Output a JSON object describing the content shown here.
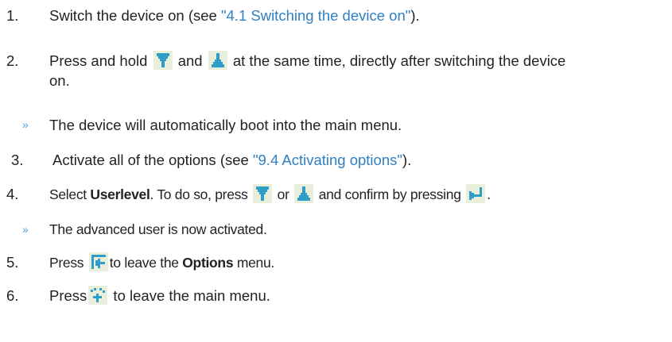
{
  "steps": [
    {
      "num": "1.",
      "pre": "Switch the device on (see ",
      "link": "\"4.1 Switching the device on\"",
      "post": ")."
    },
    {
      "num": "2.",
      "pre": "Press and hold",
      "mid": "and",
      "post": "at the same time, directly after switching the device",
      "line2": "on."
    },
    {
      "result": "The device will automatically boot into the main menu."
    },
    {
      "num": "3.",
      "pre": "Activate all of the options (see ",
      "link": "\"9.4 Activating options\"",
      "post": ")."
    },
    {
      "num": "4.",
      "pre": "Select ",
      "bold": "Userlevel",
      "mid1": ". To do so, press",
      "mid2": "or",
      "mid3": "and confirm by pressing",
      "post": "."
    },
    {
      "result": "The advanced user is now activated."
    },
    {
      "num": "5.",
      "pre": "Press",
      "mid": "to leave the ",
      "bold": "Options",
      "post": " menu."
    },
    {
      "num": "6.",
      "pre": "Press",
      "post": " to leave the main menu."
    }
  ],
  "result_marker": "»",
  "icons": {
    "down": "arrow-down-icon",
    "up": "arrow-up-icon",
    "enter": "enter-icon",
    "back": "back-icon",
    "home": "home-icon"
  },
  "colors": {
    "link": "#2f7fc1",
    "icon_fill": "#2e9ec8",
    "marker": "#5aa0d6"
  }
}
